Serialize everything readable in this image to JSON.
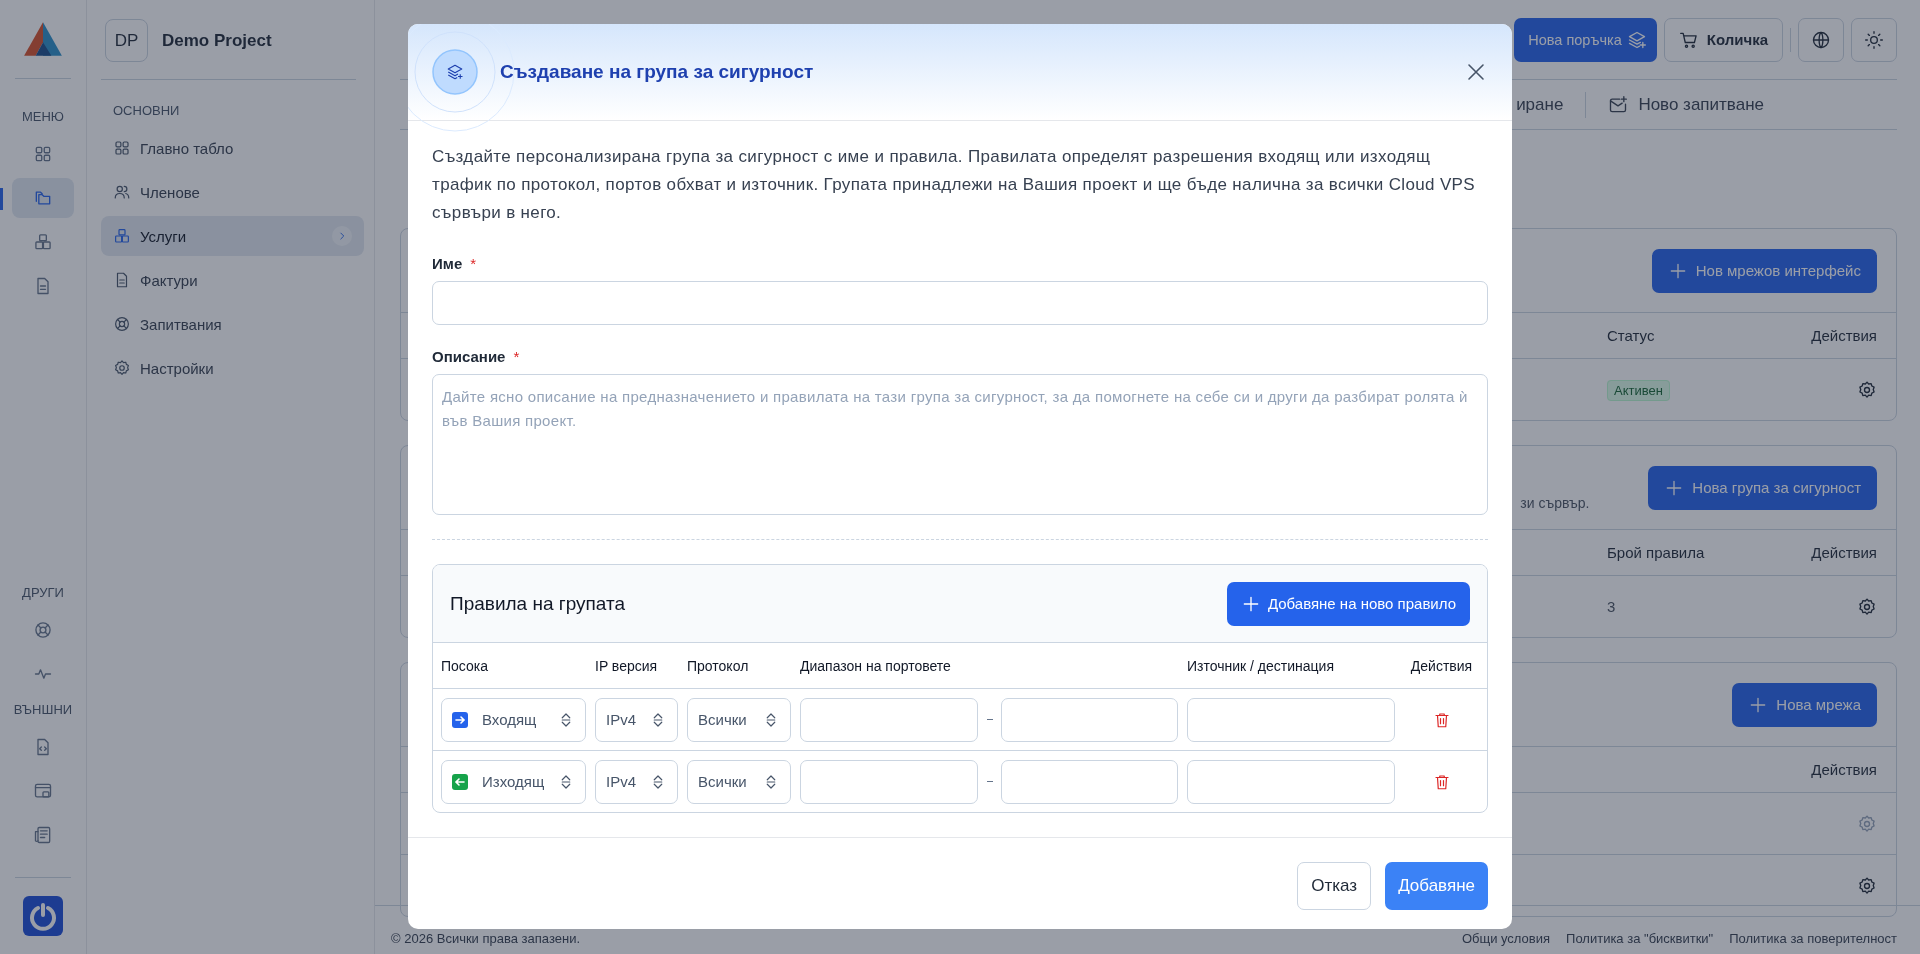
{
  "rail": {
    "groups": [
      {
        "label": "МЕНЮ",
        "items": [
          {
            "selected": false
          },
          {
            "selected": true
          },
          {
            "selected": false
          },
          {
            "selected": false
          }
        ]
      },
      {
        "label": "ДРУГИ",
        "items": [
          {
            "selected": false
          },
          {
            "selected": false
          }
        ]
      },
      {
        "label": "ВЪНШНИ",
        "items": [
          {
            "selected": false
          },
          {
            "selected": false
          },
          {
            "selected": false
          }
        ]
      }
    ]
  },
  "project": {
    "initials": "DP",
    "name": "Demo Project"
  },
  "nav": {
    "section": "ОСНОВНИ",
    "items": [
      {
        "label": "Главно табло",
        "selected": false,
        "expandable": false
      },
      {
        "label": "Членове",
        "selected": false,
        "expandable": false
      },
      {
        "label": "Услуги",
        "selected": true,
        "expandable": true
      },
      {
        "label": "Фактури",
        "selected": false,
        "expandable": false
      },
      {
        "label": "Запитвания",
        "selected": false,
        "expandable": false
      },
      {
        "label": "Настройки",
        "selected": false,
        "expandable": false
      }
    ]
  },
  "header": {
    "actions": [
      {
        "kind": "primary",
        "label": "Нова поръчка"
      },
      {
        "kind": "outline",
        "label": "Количка"
      },
      {
        "kind": "icon"
      },
      {
        "kind": "icon"
      }
    ]
  },
  "tabs": [
    {
      "label": "иране"
    },
    {
      "label": "Ново запитване"
    }
  ],
  "cards": [
    {
      "button": "Нов мрежов интерфейс",
      "columns": [
        "Статус",
        "Действия"
      ],
      "rows": [
        {
          "cells": [
            {
              "kind": "badge",
              "text": "Активен"
            }
          ],
          "disabled": false
        }
      ]
    },
    {
      "subtitle": "зи сървър.",
      "button": "Нова група за сигурност",
      "columns": [
        "Брой правила",
        "Действия"
      ],
      "rows": [
        {
          "cells": [
            {
              "kind": "text",
              "text": "3"
            }
          ],
          "disabled": false
        }
      ]
    },
    {
      "button": "Нова мрежа",
      "columns": [
        "Действия"
      ],
      "rows": [
        {
          "cells": [],
          "disabled": true
        },
        {
          "cells": [],
          "disabled": false
        }
      ]
    }
  ],
  "footer": {
    "copyright": "© 2026 Всички права запазени.",
    "links": [
      "Общи условия",
      "Политика за \"бисквитки\"",
      "Политика за поверителност"
    ]
  },
  "modal": {
    "title": "Създаване на група за сигурност",
    "description": "Създайте персонализирана група за сигурност с име и правила. Правилата определят разрешения входящ или изходящ трафик по протокол, портов обхват и източник. Групата принадлежи на Вашия проект и ще бъде налична за всички Cloud VPS сървъри в него.",
    "fields": [
      {
        "kind": "input",
        "label": "Име",
        "required_mark": "*"
      },
      {
        "kind": "textarea",
        "label": "Описание",
        "required_mark": "*",
        "placeholder": "Дайте ясно описание на предназначението и правилата на тази група за сигурност, за да помогнете на себе си и други да разбират ролята ѝ във Вашия проект."
      }
    ],
    "rules": {
      "title": "Правила на групата",
      "add_button": "Добавяне на ново правило",
      "columns": [
        "Посока",
        "IP версия",
        "Протокол",
        "Диапазон на портовете",
        "Източник / дестинация",
        "Действия"
      ],
      "rows": [
        {
          "kind": "ingress",
          "direction": "Входящ",
          "color": "#2563eb",
          "ip": "IPv4",
          "protocol": "Всички"
        },
        {
          "kind": "egress",
          "direction": "Изходящ",
          "color": "#16a34a",
          "ip": "IPv4",
          "protocol": "Всички"
        }
      ]
    },
    "buttons": [
      {
        "kind": "secondary",
        "label": "Отказ"
      },
      {
        "kind": "primary",
        "label": "Добавяне"
      }
    ]
  }
}
